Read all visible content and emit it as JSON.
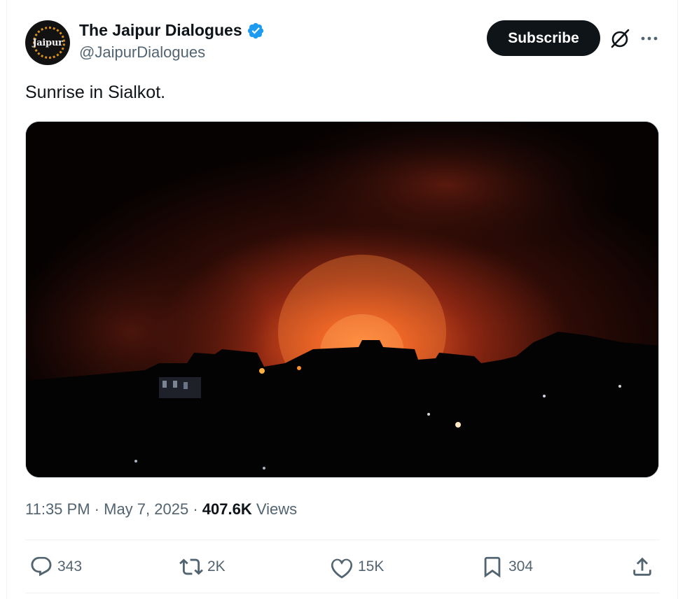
{
  "author": {
    "display_name": "The Jaipur Dialogues",
    "handle": "@JaipurDialogues",
    "avatar_text": "Jaipur",
    "verified_icon": "verified-badge-icon",
    "verified_color": "#1d9bf0"
  },
  "header": {
    "subscribe_label": "Subscribe",
    "grok_icon": "grok-icon",
    "more_icon": "more-icon"
  },
  "tweet": {
    "text": "Sunrise in Sialkot.",
    "media_alt": "Night skyline silhouette with a large orange fire glow and smoke"
  },
  "meta": {
    "time": "11:35 PM",
    "separator": "·",
    "date": "May 7, 2025",
    "views_count": "407.6K",
    "views_label": "Views"
  },
  "actions": {
    "replies": {
      "icon": "reply-icon",
      "count": "343"
    },
    "reposts": {
      "icon": "repost-icon",
      "count": "2K"
    },
    "likes": {
      "icon": "like-icon",
      "count": "15K"
    },
    "bookmarks": {
      "icon": "bookmark-icon",
      "count": "304"
    },
    "share": {
      "icon": "share-icon"
    }
  },
  "colors": {
    "text_primary": "#0f1419",
    "text_secondary": "#536471",
    "button_bg": "#0f1419",
    "fire_glow": "#e2521d"
  }
}
